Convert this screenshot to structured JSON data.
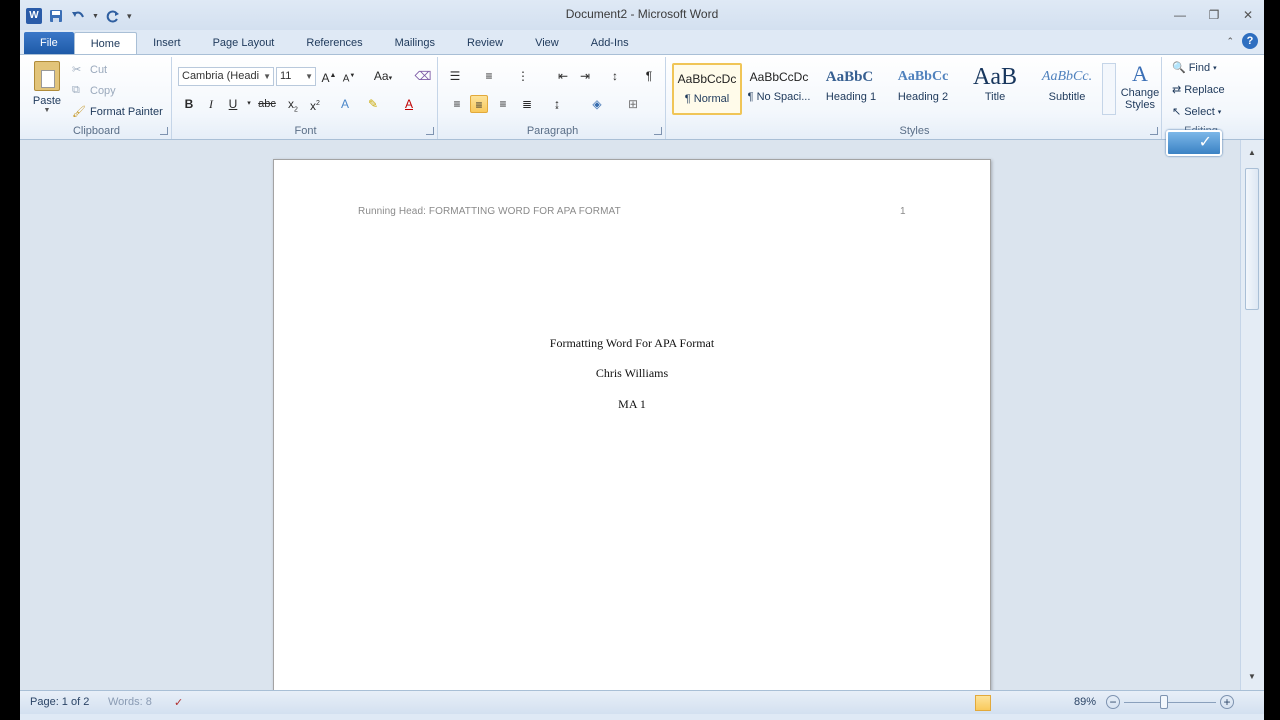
{
  "app": {
    "window_title": "Document2 - Microsoft Word"
  },
  "tabs": [
    "File",
    "Home",
    "Insert",
    "Page Layout",
    "References",
    "Mailings",
    "Review",
    "View",
    "Add-Ins"
  ],
  "active_tab": "Home",
  "ribbon": {
    "clipboard": {
      "label": "Clipboard",
      "paste": "Paste",
      "cut": "Cut",
      "copy": "Copy",
      "format_painter": "Format Painter"
    },
    "font": {
      "label": "Font",
      "font_name": "Cambria (Headi",
      "font_size": "11"
    },
    "paragraph": {
      "label": "Paragraph"
    },
    "styles": {
      "label": "Styles",
      "items": [
        {
          "sample": "AaBbCcDc",
          "name": "¶ Normal"
        },
        {
          "sample": "AaBbCcDc",
          "name": "¶ No Spaci..."
        },
        {
          "sample": "AaBbC ",
          "name": "Heading 1"
        },
        {
          "sample": "AaBbCc",
          "name": "Heading 2"
        },
        {
          "sample": "AaB",
          "name": "Title"
        },
        {
          "sample": "AaBbCc.",
          "name": "Subtitle"
        }
      ],
      "change_styles": "Change Styles"
    },
    "editing": {
      "label": "Editing",
      "find": "Find",
      "replace": "Replace",
      "select": "Select"
    }
  },
  "document": {
    "header_text": "Running Head: FORMATTING WORD FOR APA FORMAT",
    "page_number": "1",
    "lines": [
      "Formatting Word For APA Format",
      "Chris Williams",
      "MA 1"
    ]
  },
  "status": {
    "page": "Page: 1 of 2",
    "words": "Words: 8",
    "zoom": "89%"
  },
  "colors": {
    "file_tab": "#2b579a",
    "ribbon_bg": "#dfe9f5",
    "selected_highlight": "#f9c95c"
  }
}
